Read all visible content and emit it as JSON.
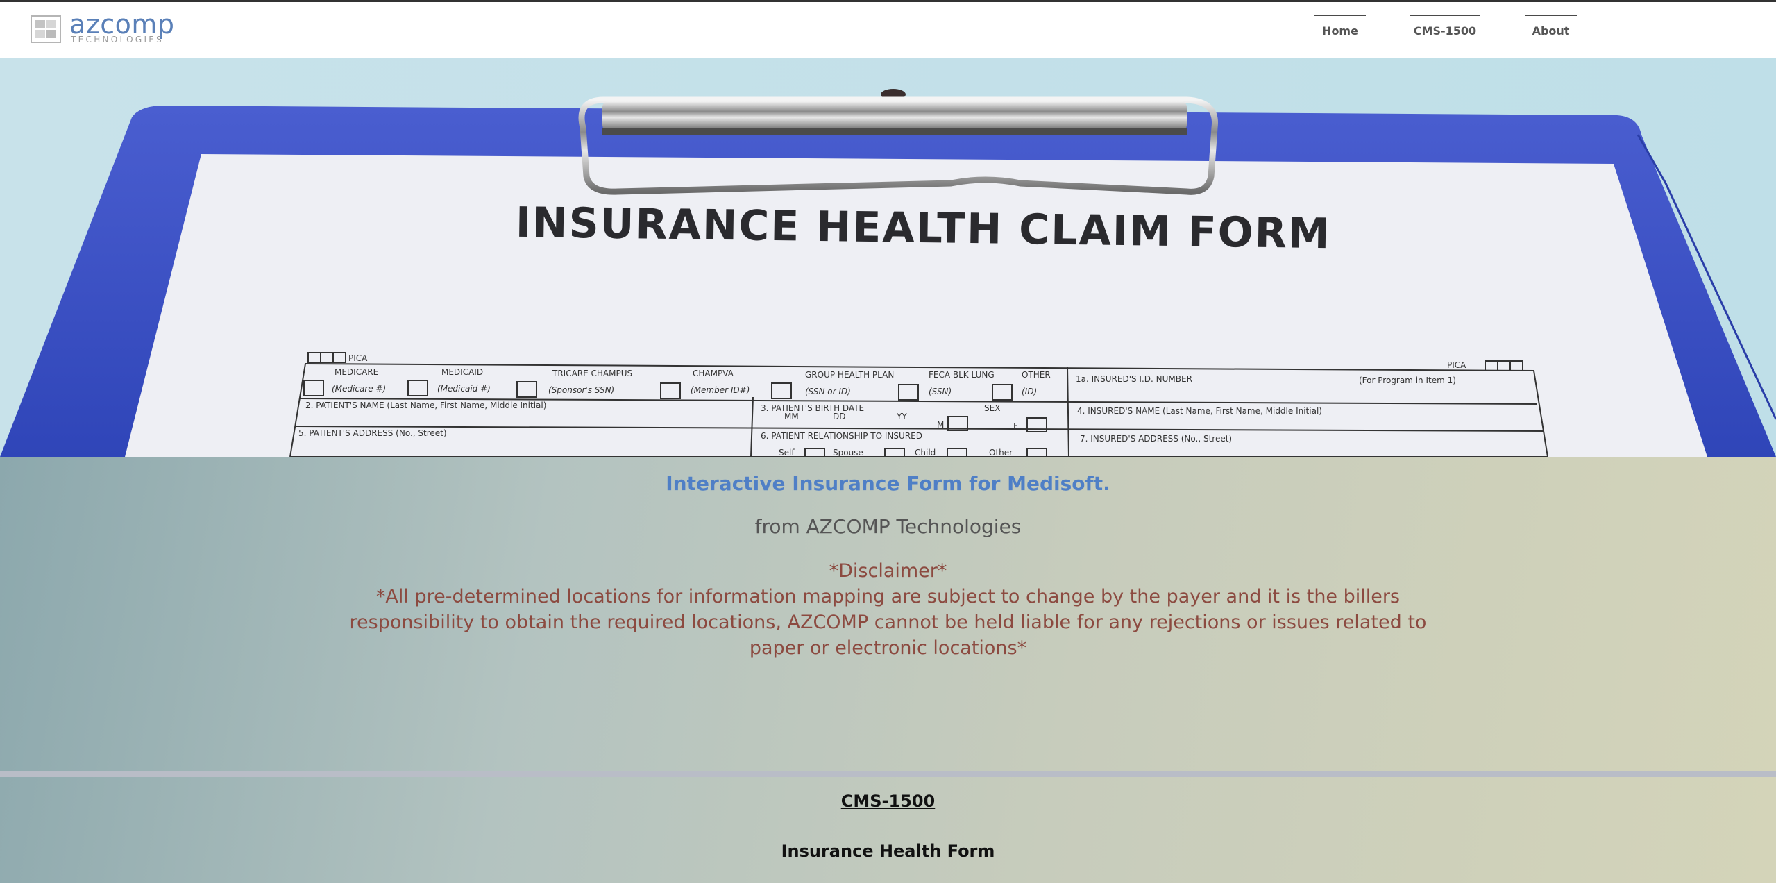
{
  "header": {
    "logo": {
      "name": "azcomp",
      "sub": "TECHNOLOGIES"
    },
    "nav": [
      {
        "label": "Home"
      },
      {
        "label": "CMS-1500"
      },
      {
        "label": "About"
      }
    ]
  },
  "hero": {
    "image_heading": "INSURANCE HEALTH CLAIM FORM",
    "form_text": {
      "pica": "PICA",
      "row1": [
        "MEDICARE",
        "MEDICAID",
        "TRICARE CHAMPUS",
        "CHAMPVA",
        "GROUP HEALTH PLAN",
        "FECA BLK LUNG",
        "OTHER"
      ],
      "row1_sub": [
        "(Medicare #)",
        "(Medicaid #)",
        "(Sponsor's SSN)",
        "(Member ID#)",
        "(SSN or ID)",
        "(SSN)",
        "(ID)"
      ],
      "insured_id": "1a. INSURED'S I.D. NUMBER",
      "for_program": "(For Program in Item 1)",
      "patient_name": "2. PATIENT'S NAME (Last Name, First Name, Middle Initial)",
      "birth_date": "3. PATIENT'S BIRTH DATE",
      "sex": "SEX",
      "mm_dd_yy": [
        "MM",
        "DD",
        "YY"
      ],
      "m": "M",
      "f": "F",
      "insured_name": "4. INSURED'S NAME (Last Name, First Name, Middle Initial)",
      "patient_address": "5. PATIENT'S ADDRESS (No., Street)",
      "relationship": "6. PATIENT RELATIONSHIP TO INSURED",
      "insured_address": "7. INSURED'S ADDRESS (No., Street)",
      "relations": [
        "Self",
        "Spouse",
        "Child",
        "Other"
      ]
    }
  },
  "main": {
    "tagline": "Interactive Insurance Form for Medisoft.",
    "from": "from AZCOMP Technologies",
    "disclaimer_title": "*Disclaimer*",
    "disclaimer_body": "*All pre-determined locations for information mapping are subject to change by the payer and it is the billers responsibility to obtain the required locations, AZCOMP cannot be held liable for any rejections or issues related to paper or electronic locations*",
    "cms_link": "CMS-1500",
    "form_title": "Insurance Health Form"
  },
  "colors": {
    "tagline": "#4f7fc6",
    "disclaimer": "#8c4a40",
    "clipboard": "#3a4fc0",
    "logo": "#5a80b8"
  }
}
